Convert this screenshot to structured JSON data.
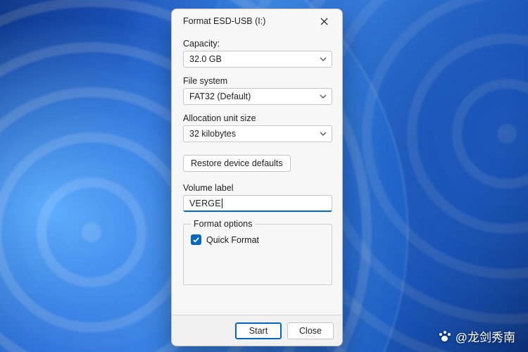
{
  "dialog": {
    "title": "Format ESD-USB (I:)",
    "capacity": {
      "label": "Capacity:",
      "value": "32.0 GB"
    },
    "filesystem": {
      "label": "File system",
      "value": "FAT32 (Default)"
    },
    "allocation": {
      "label": "Allocation unit size",
      "value": "32 kilobytes"
    },
    "restore_label": "Restore device defaults",
    "volume": {
      "label": "Volume label",
      "value": "VERGE"
    },
    "options": {
      "legend": "Format options",
      "quick_format": {
        "label": "Quick Format",
        "checked": true
      }
    },
    "buttons": {
      "start": "Start",
      "close": "Close"
    }
  },
  "watermark": "@龙剑秀南"
}
